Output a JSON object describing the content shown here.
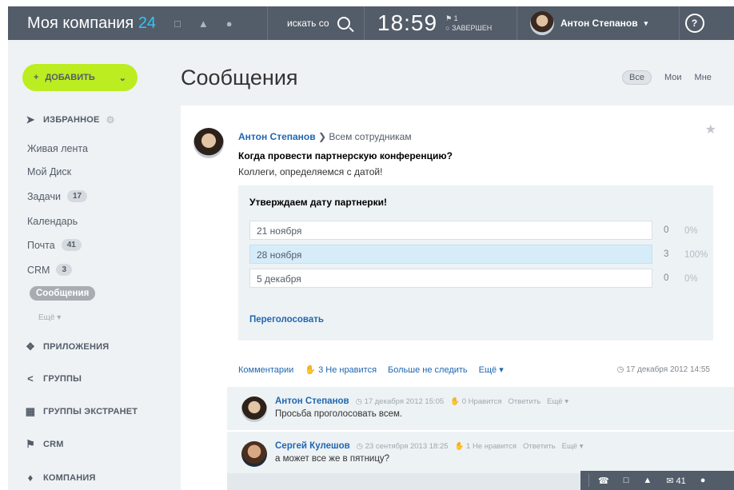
{
  "header": {
    "logo_text": "Моя компания",
    "logo_num": "24",
    "icon_chat": "chat-icon",
    "icon_bell": "bell-icon",
    "icon_cloud": "cloud-icon",
    "search_label": "искать со",
    "time": "18:59",
    "flag_count": "1",
    "status": "ЗАВЕРШЕН",
    "user_name": "Антон Степанов",
    "help": "?"
  },
  "sidebar": {
    "add_button": "ДОБАВИТЬ",
    "favorites": "ИЗБРАННОЕ",
    "items": [
      {
        "label": "Живая лента",
        "counter": ""
      },
      {
        "label": "Мой Диск",
        "counter": ""
      },
      {
        "label": "Задачи",
        "counter": "17"
      },
      {
        "label": "Календарь",
        "counter": ""
      },
      {
        "label": "Почта",
        "counter": "41"
      },
      {
        "label": "CRM",
        "counter": "3"
      }
    ],
    "active_item": "Сообщения",
    "more": "Ещё",
    "sections": [
      "ПРИЛОЖЕНИЯ",
      "ГРУППЫ",
      "ГРУППЫ ЭКСТРАНЕТ",
      "CRM",
      "КОМПАНИЯ"
    ]
  },
  "main": {
    "title": "Сообщения",
    "filters": [
      "Все",
      "Мои",
      "Мне"
    ]
  },
  "post": {
    "author": "Антон Степанов",
    "recipient": "Всем сотрудникам",
    "title": "Когда провести партнерскую конференцию?",
    "text": "Коллеги, определяемся с датой!",
    "poll": {
      "question": "Утверждаем дату партнерки!",
      "options": [
        {
          "label": "21 ноября",
          "count": "0",
          "percent": "0%"
        },
        {
          "label": "28 ноября",
          "count": "3",
          "percent": "100%"
        },
        {
          "label": "5 декабря",
          "count": "0",
          "percent": "0%"
        }
      ],
      "revote": "Переголосовать"
    },
    "actions": {
      "comments": "Комментарии",
      "likes": "3",
      "dislike": "Не нравится",
      "unfollow": "Больше не следить",
      "more": "Ещё"
    },
    "date": "17 декабря 2012 14:55"
  },
  "comments": [
    {
      "author": "Антон Степанов",
      "date": "17 декабря 2012 15:05",
      "likes": "0 Нравится",
      "reply": "Ответить",
      "more": "Ещё",
      "text": "Просьба проголосовать всем."
    },
    {
      "author": "Сергей Кулешов",
      "date": "23 сентября 2013 18:25",
      "likes": "1 Не нравится",
      "reply": "Ответить",
      "more": "Ещё",
      "text": "а может все же в пятницу?"
    }
  ],
  "bottom_bar": {
    "mail_count": "41"
  }
}
